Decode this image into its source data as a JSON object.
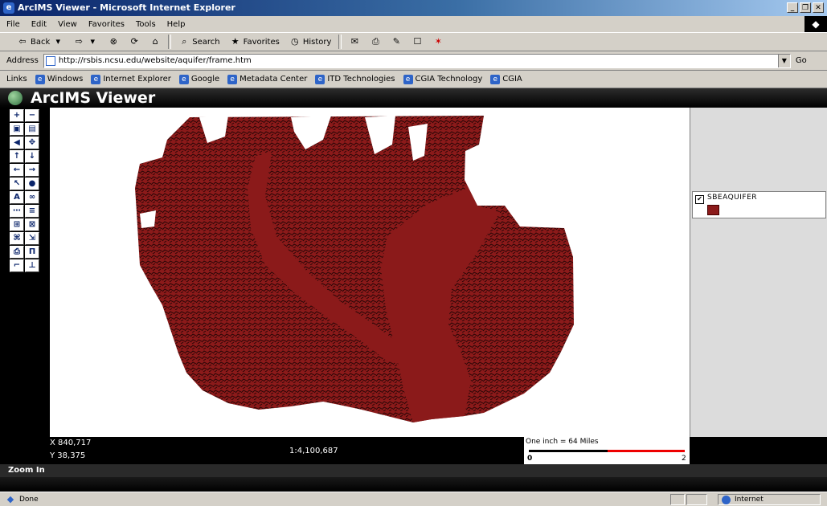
{
  "window": {
    "title": "ArcIMS Viewer - Microsoft Internet Explorer",
    "controls": [
      "_",
      "❐",
      "✕"
    ]
  },
  "menu": [
    "File",
    "Edit",
    "View",
    "Favorites",
    "Tools",
    "Help"
  ],
  "toolbar": {
    "back_label": "Back",
    "search_label": "Search",
    "favorites_label": "Favorites",
    "history_label": "History"
  },
  "address": {
    "label": "Address",
    "value": "http://rsbis.ncsu.edu/website/aquifer/frame.htm",
    "go_label": "Go"
  },
  "links": {
    "label": "Links",
    "items": [
      "Windows",
      "Internet Explorer",
      "Google",
      "Metadata Center",
      "ITD Technologies",
      "CGIA Technology",
      "CGIA"
    ]
  },
  "viewer": {
    "title": "ArcIMS Viewer"
  },
  "tools": [
    "zoom-in",
    "zoom-out",
    "zoom-full",
    "zoom-active",
    "zoom-last",
    "pan",
    "pan-north",
    "pan-south",
    "pan-west",
    "pan-east",
    "identify",
    "info",
    "find",
    "binoculars",
    "measure",
    "select",
    "query",
    "clear-selection",
    "hyperlink",
    "buffer",
    "print",
    "options",
    "legend",
    "overview"
  ],
  "legend": {
    "layer_name": "SBEAQUIFER",
    "checked": true,
    "swatch_color": "#8b1a1a"
  },
  "status": {
    "x_coord": "X 840,717",
    "y_coord": "Y 38,375",
    "scale": "1:4,100,687",
    "scalebar_label": "One inch = 64 Miles",
    "scalebar_zero": "0",
    "scalebar_end": "2"
  },
  "mode": "Zoom In",
  "ie_status": {
    "text": "Done",
    "zone": "Internet"
  },
  "map": {
    "fill_color": "#8b1a1a",
    "background": "#ffffff"
  }
}
